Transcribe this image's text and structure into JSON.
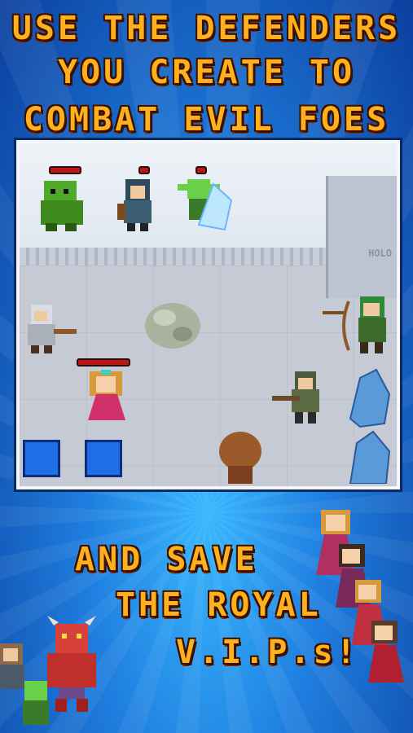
{
  "headline": {
    "line1": "USE THE DEFENDERS",
    "line2": "YOU CREATE TO",
    "line3": "COMBAT EVIL FOES"
  },
  "scene": {
    "wall_sign": "HOLO"
  },
  "tagline": {
    "line1": "AND SAVE",
    "line2": "THE ROYAL",
    "line3": "V.I.P.s!"
  },
  "colors": {
    "title_orange": "#ffb01f",
    "background_blue": "#1f7fe0"
  }
}
